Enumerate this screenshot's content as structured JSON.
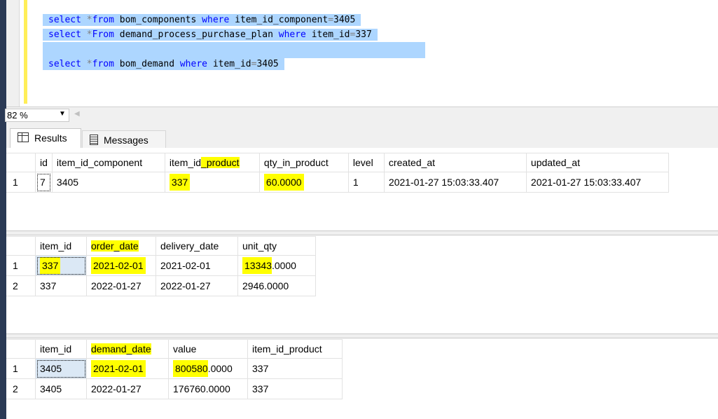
{
  "editor": {
    "lines": [
      {
        "k1": "select",
        "op": " *",
        "k2": "from",
        "txt1": " bom_components ",
        "k3": "where",
        "txt2": " item_id_component",
        "eq": "=",
        "val": "3405"
      },
      {
        "k1": "select",
        "op": " *",
        "k2": "From",
        "txt1": " demand_process_purchase_plan ",
        "k3": "where",
        "txt2": " item_id",
        "eq": "=",
        "val": "337"
      },
      {
        "k1": "select",
        "op": " *",
        "k2": "from",
        "txt1": " bom_demand ",
        "k3": "where",
        "txt2": " item_id",
        "eq": "=",
        "val": "3405"
      }
    ]
  },
  "zoom": {
    "value": "82 %"
  },
  "tabs": {
    "results": "Results",
    "messages": "Messages"
  },
  "grid1": {
    "headers": [
      "id",
      "item_id_component",
      "item_id_product",
      "qty_in_product",
      "level",
      "created_at",
      "updated_at"
    ],
    "header_prefix_item": "item_id",
    "header_suffix_product": "_product",
    "rows": [
      {
        "rn": "1",
        "id": "7",
        "item_id_component": "3405",
        "item_id_product": "337",
        "qty_in_product": "60.0000",
        "level": "1",
        "created_at": "2021-01-27 15:03:33.407",
        "updated_at": "2021-01-27 15:03:33.407"
      }
    ]
  },
  "grid2": {
    "headers": [
      "item_id",
      "order_date",
      "delivery_date",
      "unit_qty"
    ],
    "rows": [
      {
        "rn": "1",
        "item_id": "337",
        "order_date": "2021-02-01",
        "delivery_date": "2021-02-01",
        "unit_qty_hl": "13343",
        "unit_qty_rest": ".0000"
      },
      {
        "rn": "2",
        "item_id": "337",
        "order_date": "2022-01-27",
        "delivery_date": "2022-01-27",
        "unit_qty": "2946.0000"
      }
    ]
  },
  "grid3": {
    "headers": [
      "item_id",
      "demand_date",
      "value",
      "item_id_product"
    ],
    "rows": [
      {
        "rn": "1",
        "item_id": "3405",
        "demand_date": "2021-02-01",
        "value_hl": "800580",
        "value_rest": ".0000",
        "item_id_product": "337"
      },
      {
        "rn": "2",
        "item_id": "3405",
        "demand_date": "2022-01-27",
        "value": "176760.0000",
        "item_id_product": "337"
      }
    ]
  },
  "colors": {
    "selection": "#add6ff",
    "highlight": "#ffff00",
    "keyword": "#0000ff"
  }
}
